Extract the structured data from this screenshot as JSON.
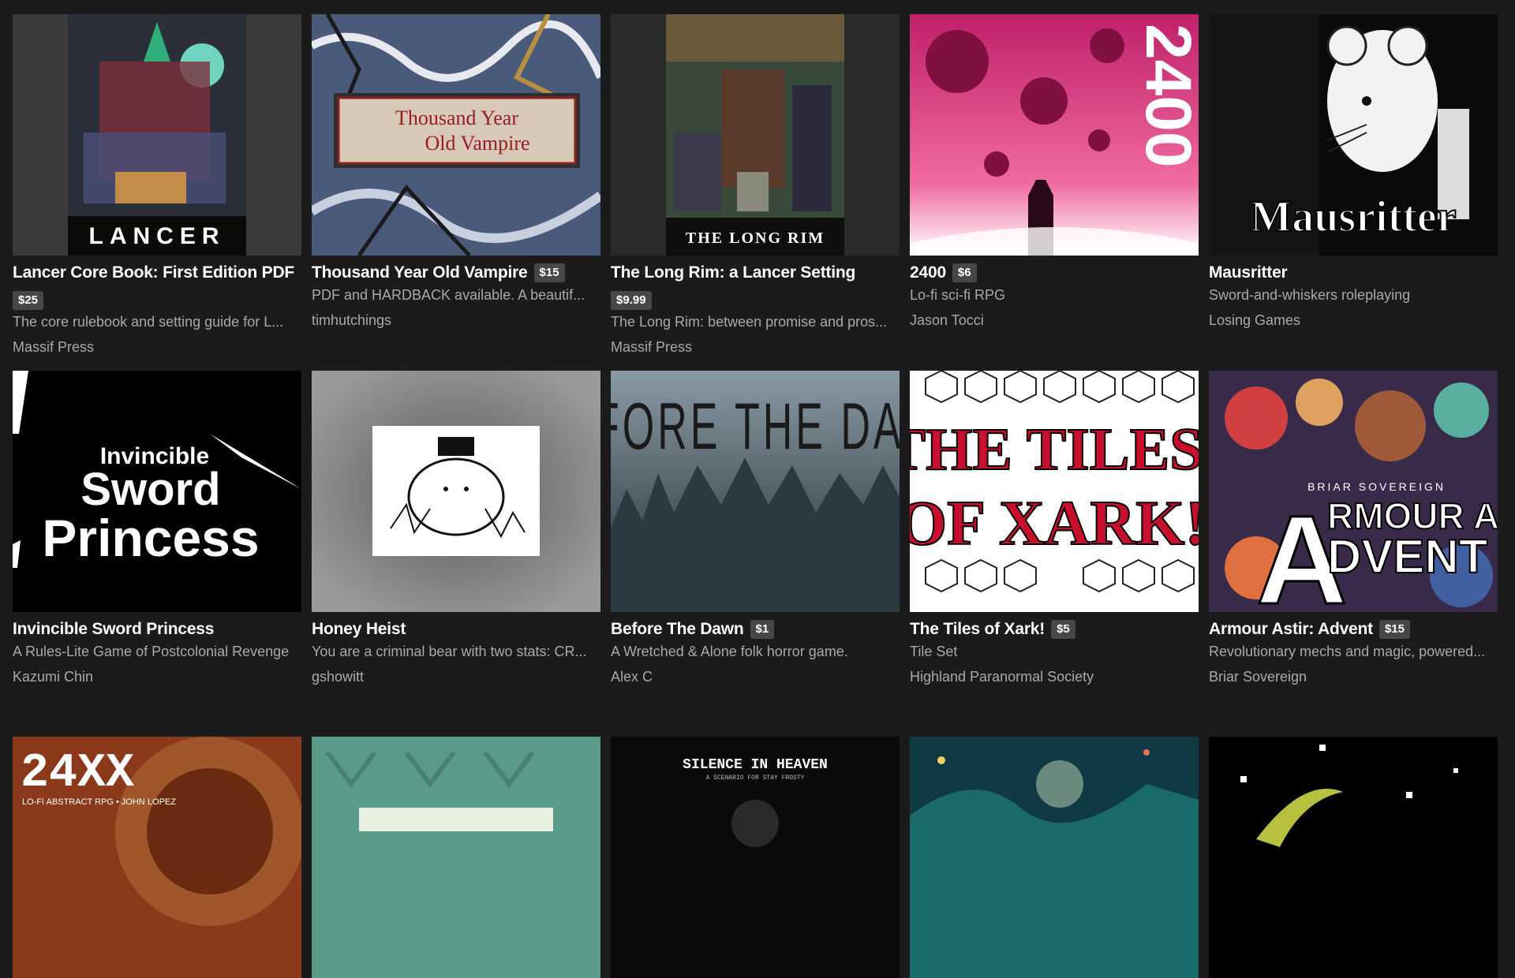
{
  "games": [
    {
      "title": "Lancer Core Book: First Edition PDF",
      "price": "$25",
      "description": "The core rulebook and setting guide for L...",
      "author": "Massif Press",
      "cover_text": "LANCER"
    },
    {
      "title": "Thousand Year Old Vampire",
      "price": "$15",
      "description": "PDF and HARDBACK available. A beautif...",
      "author": "timhutchings",
      "cover_text": "Thousand Year Old Vampire"
    },
    {
      "title": "The Long Rim: a Lancer Setting",
      "price": "$9.99",
      "description": "The Long Rim: between promise and pros...",
      "author": "Massif Press",
      "cover_text": "THE LONG RIM"
    },
    {
      "title": "2400",
      "price": "$6",
      "description": "Lo-fi sci-fi RPG",
      "author": "Jason Tocci",
      "cover_text": "2400"
    },
    {
      "title": "Mausritter",
      "price": "",
      "description": "Sword-and-whiskers roleplaying",
      "author": "Losing Games",
      "cover_text": "Mausritter"
    },
    {
      "title": "Invincible Sword Princess",
      "price": "",
      "description": "A Rules-Lite Game of Postcolonial Revenge",
      "author": "Kazumi Chin",
      "cover_text": "Invincible Sword Princess"
    },
    {
      "title": "Honey Heist",
      "price": "",
      "description": "You are a criminal bear with two stats: CR...",
      "author": "gshowitt",
      "cover_text": ""
    },
    {
      "title": "Before The Dawn",
      "price": "$1",
      "description": "A Wretched & Alone folk horror game.",
      "author": "Alex C",
      "cover_text": "BEFORE THE DAWN"
    },
    {
      "title": "The Tiles of Xark!",
      "price": "$5",
      "description": "Tile Set",
      "author": "Highland Paranormal Society",
      "cover_text": "THE TILES OF XARK!"
    },
    {
      "title": "Armour Astir: Advent",
      "price": "$15",
      "description": "Revolutionary mechs and magic, powered...",
      "author": "Briar Sovereign",
      "cover_text": "ARMOUR ASTIR ADVENT"
    },
    {
      "cover_text": "24XX",
      "cover_subtext": "LO-FI ABSTRACT RPG • JOHN LOPEZ"
    },
    {
      "cover_text": ""
    },
    {
      "cover_text": "SILENCE IN HEAVEN",
      "cover_subtext": "A SCENARIO FOR STAY FROSTY"
    },
    {
      "cover_text": ""
    },
    {
      "cover_text": ""
    }
  ]
}
